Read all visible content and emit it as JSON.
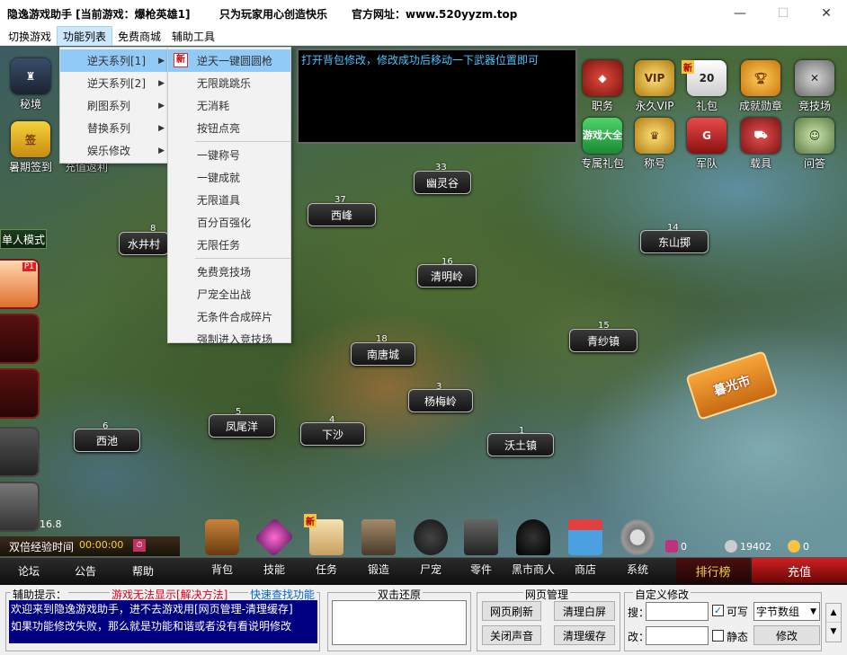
{
  "titlebar": {
    "app_title": "隐逸游戏助手 [当前游戏：爆枪英雄1]",
    "slogan": "只为玩家用心创造快乐",
    "website": "官方网址：www.520yyzm.top",
    "minimize": "—",
    "maximize": "☐",
    "close": "✕"
  },
  "menubar": {
    "items": [
      "切换游戏",
      "功能列表",
      "免费商城",
      "辅助工具"
    ]
  },
  "func_menu": {
    "items": [
      "逆天系列[1]",
      "逆天系列[2]",
      "刷图系列",
      "替换系列",
      "娱乐修改"
    ]
  },
  "submenu": {
    "new_badge": "新",
    "items": [
      "逆天一键圆圆枪",
      "无限跳跳乐",
      "无消耗",
      "按钮点亮",
      "一键称号",
      "一键成就",
      "无限道具",
      "百分百强化",
      "无限任务",
      "免费竞技场",
      "尸宠全出战",
      "无条件合成碎片",
      "强制进入竞技场"
    ]
  },
  "console": {
    "text": "打开背包修改，修改成功后移动一下武器位置即可"
  },
  "left_icons": {
    "secret": "秘境",
    "signin": "暑期签到",
    "recharge_partial": "充值返利",
    "single_mode": "单人模式",
    "p1": "P1",
    "level": "16.8"
  },
  "right_icons": {
    "row1": [
      "职务",
      "永久VIP",
      "礼包",
      "成就勋章",
      "竞技场"
    ],
    "row2": [
      "专属礼包",
      "称号",
      "军队",
      "载具",
      "问答"
    ],
    "vip_badge": "VIP",
    "new_badge": "新",
    "gift_num": "20",
    "game_all": "游戏大全"
  },
  "map": {
    "labels": [
      {
        "num": "33",
        "name": "幽灵谷"
      },
      {
        "num": "37",
        "name": "西峰"
      },
      {
        "num": "8",
        "name": "水井村"
      },
      {
        "num": "16",
        "name": "清明岭"
      },
      {
        "num": "14",
        "name": "东山掷"
      },
      {
        "num": "18",
        "name": "南唐城"
      },
      {
        "num": "15",
        "name": "青纱镇"
      },
      {
        "num": "3",
        "name": "杨梅岭"
      },
      {
        "num": "6",
        "name": "西池"
      },
      {
        "num": "5",
        "name": "凤尾洋"
      },
      {
        "num": "4",
        "name": "下沙"
      },
      {
        "num": "1",
        "name": "沃土镇"
      }
    ],
    "arrow_label": "暮光市"
  },
  "bottom": {
    "double_exp": "双倍经验时间",
    "timer": "00:00:00",
    "items": [
      "背包",
      "技能",
      "任务",
      "锻造",
      "尸宠",
      "零件",
      "黑市商人",
      "商店",
      "系统"
    ],
    "new_badge": "新",
    "tabs_left": [
      "论坛",
      "公告",
      "帮助"
    ],
    "currency1_value": "0",
    "currency2_value": "19402",
    "currency3_value": "0",
    "rank_button": "排行榜",
    "recharge_button": "充值"
  },
  "panel": {
    "hint_title": "辅助提示：",
    "hint_link1": "游戏无法显示[解决方法]",
    "hint_link2": "快速查找功能",
    "hint_line1": "欢迎来到隐逸游戏助手，进不去游戏用[网页管理-清理缓存]",
    "hint_line2": "如果功能修改失败，那么就是功能和谐或者没有看说明修改",
    "restore_title": "双击还原",
    "web_title": "网页管理",
    "btn_refresh": "网页刷新",
    "btn_clear_white": "清理白屏",
    "btn_mute": "关闭声音",
    "btn_clear_cache": "清理缓存",
    "custom_title": "自定义修改",
    "search_label": "搜：",
    "edit_label": "改：",
    "writable_label": "可写",
    "static_label": "静态",
    "type_select": "字节数组",
    "modify_button": "修改"
  },
  "colors": {
    "menu_highlight": "#91c9f7",
    "console_text": "#4cc3ff",
    "link_red": "#e0001a",
    "link_blue": "#0066cc",
    "hint_bg": "#000080"
  }
}
